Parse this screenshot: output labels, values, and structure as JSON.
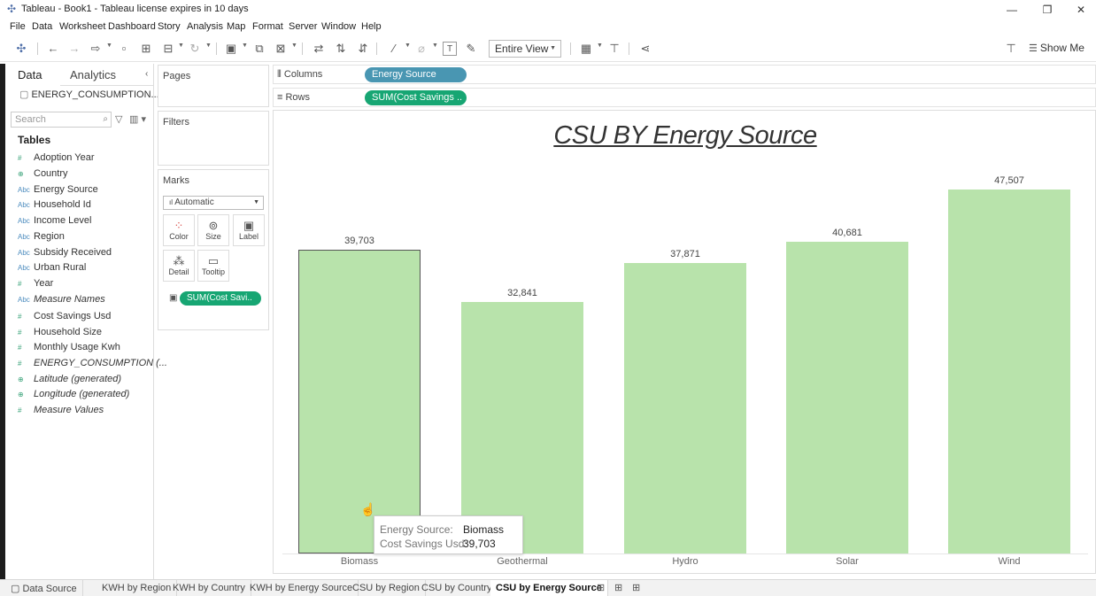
{
  "window": {
    "title": "Tableau - Book1 - Tableau license expires in 10 days",
    "minimize": "—",
    "restore": "❐",
    "close": "✕"
  },
  "menu": [
    "File",
    "Data",
    "Worksheet",
    "Dashboard",
    "Story",
    "Analysis",
    "Map",
    "Format",
    "Server",
    "Window",
    "Help"
  ],
  "toolbar": {
    "view_select": "Entire View",
    "show_me": "Show Me"
  },
  "data_pane": {
    "tab_data": "Data",
    "tab_analytics": "Analytics",
    "datasource": "ENERGY_CONSUMPTION...",
    "search_placeholder": "Search",
    "tables_heading": "Tables",
    "fields": [
      {
        "type": "#",
        "name": "Adoption Year"
      },
      {
        "type": "globe",
        "name": "Country"
      },
      {
        "type": "Abc",
        "name": "Energy Source"
      },
      {
        "type": "Abc",
        "name": "Household Id"
      },
      {
        "type": "Abc",
        "name": "Income Level"
      },
      {
        "type": "Abc",
        "name": "Region"
      },
      {
        "type": "Abc",
        "name": "Subsidy Received"
      },
      {
        "type": "Abc",
        "name": "Urban Rural"
      },
      {
        "type": "#",
        "name": "Year"
      },
      {
        "type": "Abc",
        "name": "Measure Names"
      },
      {
        "type": "#",
        "name": "Cost Savings Usd"
      },
      {
        "type": "#",
        "name": "Household Size"
      },
      {
        "type": "#",
        "name": "Monthly Usage Kwh"
      },
      {
        "type": "#",
        "name": "ENERGY_CONSUMPTION (..."
      },
      {
        "type": "globe",
        "name": "Latitude (generated)"
      },
      {
        "type": "globe",
        "name": "Longitude (generated)"
      },
      {
        "type": "#",
        "name": "Measure Values"
      }
    ]
  },
  "cards": {
    "pages": "Pages",
    "filters": "Filters",
    "marks": "Marks",
    "marks_type": "Automatic",
    "mark_buttons": [
      "Color",
      "Size",
      "Label",
      "Detail",
      "Tooltip"
    ],
    "mark_pill": "SUM(Cost Savi.."
  },
  "shelves": {
    "columns_label": "Columns",
    "columns_pill": "Energy Source",
    "columns_color": "#4996b2",
    "rows_label": "Rows",
    "rows_pill": "SUM(Cost Savings ..",
    "rows_color": "#17a673"
  },
  "tooltip": {
    "key1": "Energy Source:",
    "val1": "Biomass",
    "key2": "Cost Savings Usd:",
    "val2": "39,703"
  },
  "sheet_tabs": [
    {
      "label": "Data Source",
      "active": false
    },
    {
      "label": "KWH by Region",
      "active": false
    },
    {
      "label": "KWH by Country",
      "active": false
    },
    {
      "label": "KWH by Energy Source",
      "active": false
    },
    {
      "label": "CSU by Region",
      "active": false
    },
    {
      "label": "CSU by Country",
      "active": false
    },
    {
      "label": "CSU by Energy Source",
      "active": true
    }
  ],
  "chart_data": {
    "type": "bar",
    "title": "CSU BY Energy Source",
    "categories": [
      "Biomass",
      "Geothermal",
      "Hydro",
      "Solar",
      "Wind"
    ],
    "values": [
      39703,
      32841,
      37871,
      40681,
      47507
    ],
    "value_labels": [
      "39,703",
      "32,841",
      "37,871",
      "40,681",
      "47,507"
    ],
    "selected": "Biomass",
    "bar_color": "#b8e3ab",
    "ylim": [
      0,
      47507
    ]
  }
}
